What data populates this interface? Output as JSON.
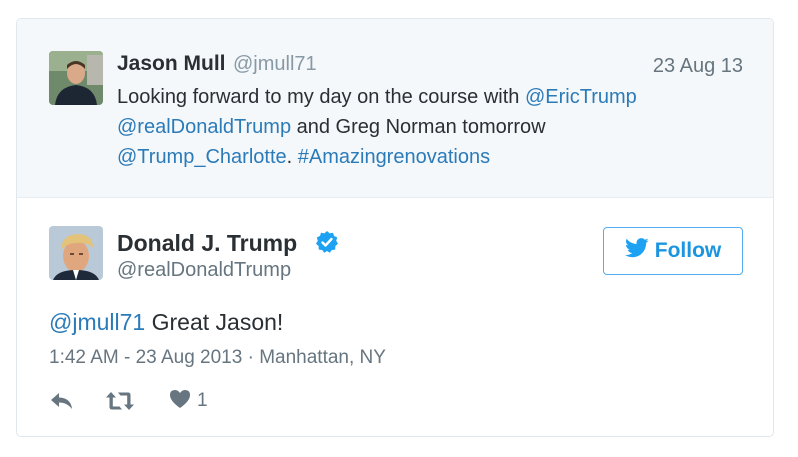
{
  "context_tweet": {
    "name": "Jason Mull",
    "handle": "@jmull71",
    "date": "23 Aug 13",
    "text": {
      "part1": "Looking forward to my day on the course with ",
      "mention1": "@EricTrump",
      "mention2": "@realDonaldTrump",
      "part2": " and Greg Norman tomorrow",
      "mention3": "@Trump_Charlotte",
      "part3": ". ",
      "hashtag": "#Amazingrenovations"
    }
  },
  "main_tweet": {
    "name": "Donald J. Trump",
    "handle": "@realDonaldTrump",
    "follow_label": "Follow",
    "reply_mention": "@jmull71",
    "text": " Great Jason!",
    "timestamp": "1:42 AM - 23 Aug 2013",
    "separator": " · ",
    "location": "Manhattan, NY",
    "like_count": "1"
  },
  "colors": {
    "link": "#2b7bb9",
    "twitter_blue": "#1da1f2",
    "context_bg": "#f5f8fa"
  },
  "icons": [
    "reply-icon",
    "retweet-icon",
    "heart-icon",
    "verified-icon",
    "twitter-bird-icon"
  ]
}
